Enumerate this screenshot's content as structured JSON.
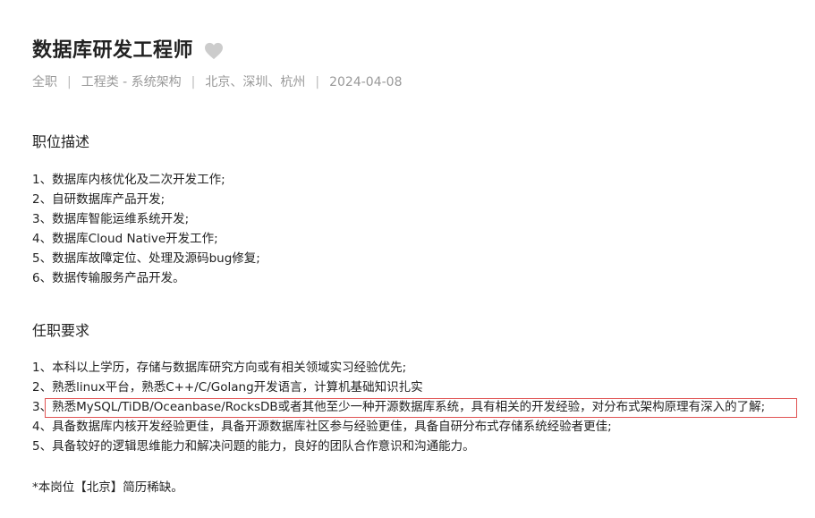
{
  "job": {
    "title": "数据库研发工程师",
    "meta": [
      "全职",
      "工程类 - 系统架构",
      "北京、深圳、杭州",
      "2024-04-08"
    ],
    "separator": "|"
  },
  "description": {
    "heading": "职位描述",
    "items": [
      "1、数据库内核优化及二次开发工作;",
      "2、自研数据库产品开发;",
      "3、数据库智能运维系统开发;",
      "4、数据库Cloud Native开发工作;",
      "5、数据库故障定位、处理及源码bug修复;",
      "6、数据传输服务产品开发。"
    ]
  },
  "requirements": {
    "heading": "任职要求",
    "items": [
      "1、本科以上学历，存储与数据库研究方向或有相关领域实习经验优先;",
      "2、熟悉linux平台，熟悉C++/C/Golang开发语言，计算机基础知识扎实",
      "3、熟悉MySQL/TiDB/Oceanbase/RocksDB或者其他至少一种开源数据库系统，具有相关的开发经验，对分布式架构原理有深入的了解;",
      "4、具备数据库内核开发经验更佳，具备开源数据库社区参与经验更佳，具备自研分布式存储系统经验者更佳;",
      "5、具备较好的逻辑思维能力和解决问题的能力，良好的团队合作意识和沟通能力。"
    ]
  },
  "note": "*本岗位【北京】简历稀缺。",
  "colors": {
    "highlight_border": "#e05353",
    "meta_text": "#999999",
    "heart_fill": "#cccccc"
  }
}
